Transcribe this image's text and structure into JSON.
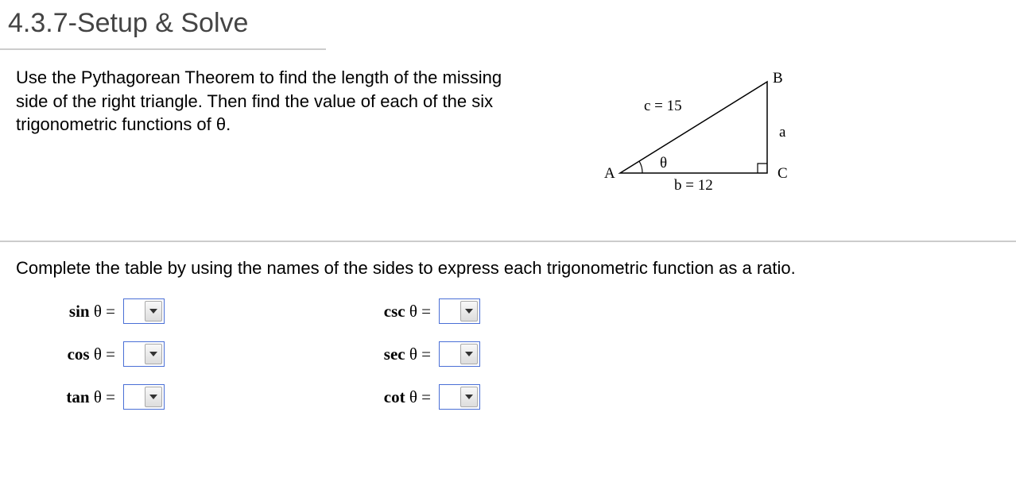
{
  "header": "4.3.7-Setup & Solve",
  "problem_text": "Use the Pythagorean Theorem to find the length of the missing side of the right triangle. Then find the value of each of the six trigonometric functions of θ.",
  "triangle": {
    "vertex_A": "A",
    "vertex_B": "B",
    "vertex_C": "C",
    "side_a": "a",
    "side_b": "b = 12",
    "side_c": "c = 15",
    "angle": "θ"
  },
  "instruction": "Complete the table by using the names of the sides to express each trigonometric function as a ratio.",
  "functions": {
    "sin": {
      "name": "sin",
      "equals": " θ ="
    },
    "cos": {
      "name": "cos",
      "equals": " θ ="
    },
    "tan": {
      "name": "tan",
      "equals": " θ ="
    },
    "csc": {
      "name": "csc",
      "equals": " θ ="
    },
    "sec": {
      "name": "sec",
      "equals": " θ ="
    },
    "cot": {
      "name": "cot",
      "equals": " θ ="
    }
  }
}
